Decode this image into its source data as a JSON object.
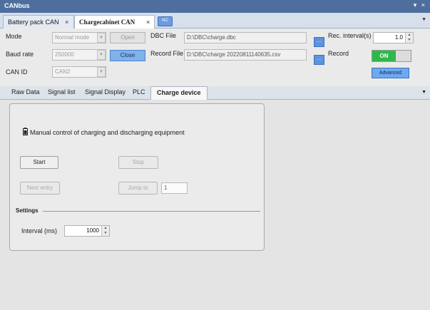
{
  "window": {
    "title": "CANbus",
    "controls": "▾ ×"
  },
  "doc_tabs": [
    {
      "label": "Battery pack CAN",
      "close": "×"
    },
    {
      "label": "Chargecabinet CAN",
      "close": "×"
    }
  ],
  "doc_tab_pill": "NC",
  "doc_tab_menu": "▼",
  "config": {
    "mode_label": "Mode",
    "mode_value": "Normal mode",
    "open_button": "Open",
    "baud_label": "Baud rate",
    "baud_value": "250000",
    "close_button": "Close",
    "canid_label": "CAN ID",
    "canid_value": "CAN2",
    "dbc_label": "DBC File",
    "dbc_value": "D:\\DBC\\charge.dbc",
    "record_file_label": "Record File",
    "record_file_value": "D:\\DBC\\charge 20220811140635.csv",
    "browse": "...",
    "rec_interval_label": "Rec. interval(s)",
    "rec_interval_value": "1.0",
    "record_label": "Record",
    "record_toggle": "ON",
    "advanced_button": "Advanced",
    "dropdown_glyph": "▼",
    "spin_up": "▲",
    "spin_down": "▼"
  },
  "func_tabs": [
    "Raw Data",
    "Signal list",
    "Signal Display",
    "PLC",
    "Charge device"
  ],
  "func_tab_menu": "▼",
  "charge_panel": {
    "heading": "Manual control of charging and discharging equipment",
    "start_button": "Start",
    "stop_button": "Stop",
    "next_entry_button": "Next entry",
    "jump_to_button": "Jump to",
    "jump_to_value": "1",
    "settings_label": "Settings",
    "interval_label": "Interval (ms)",
    "interval_value": "1000"
  }
}
